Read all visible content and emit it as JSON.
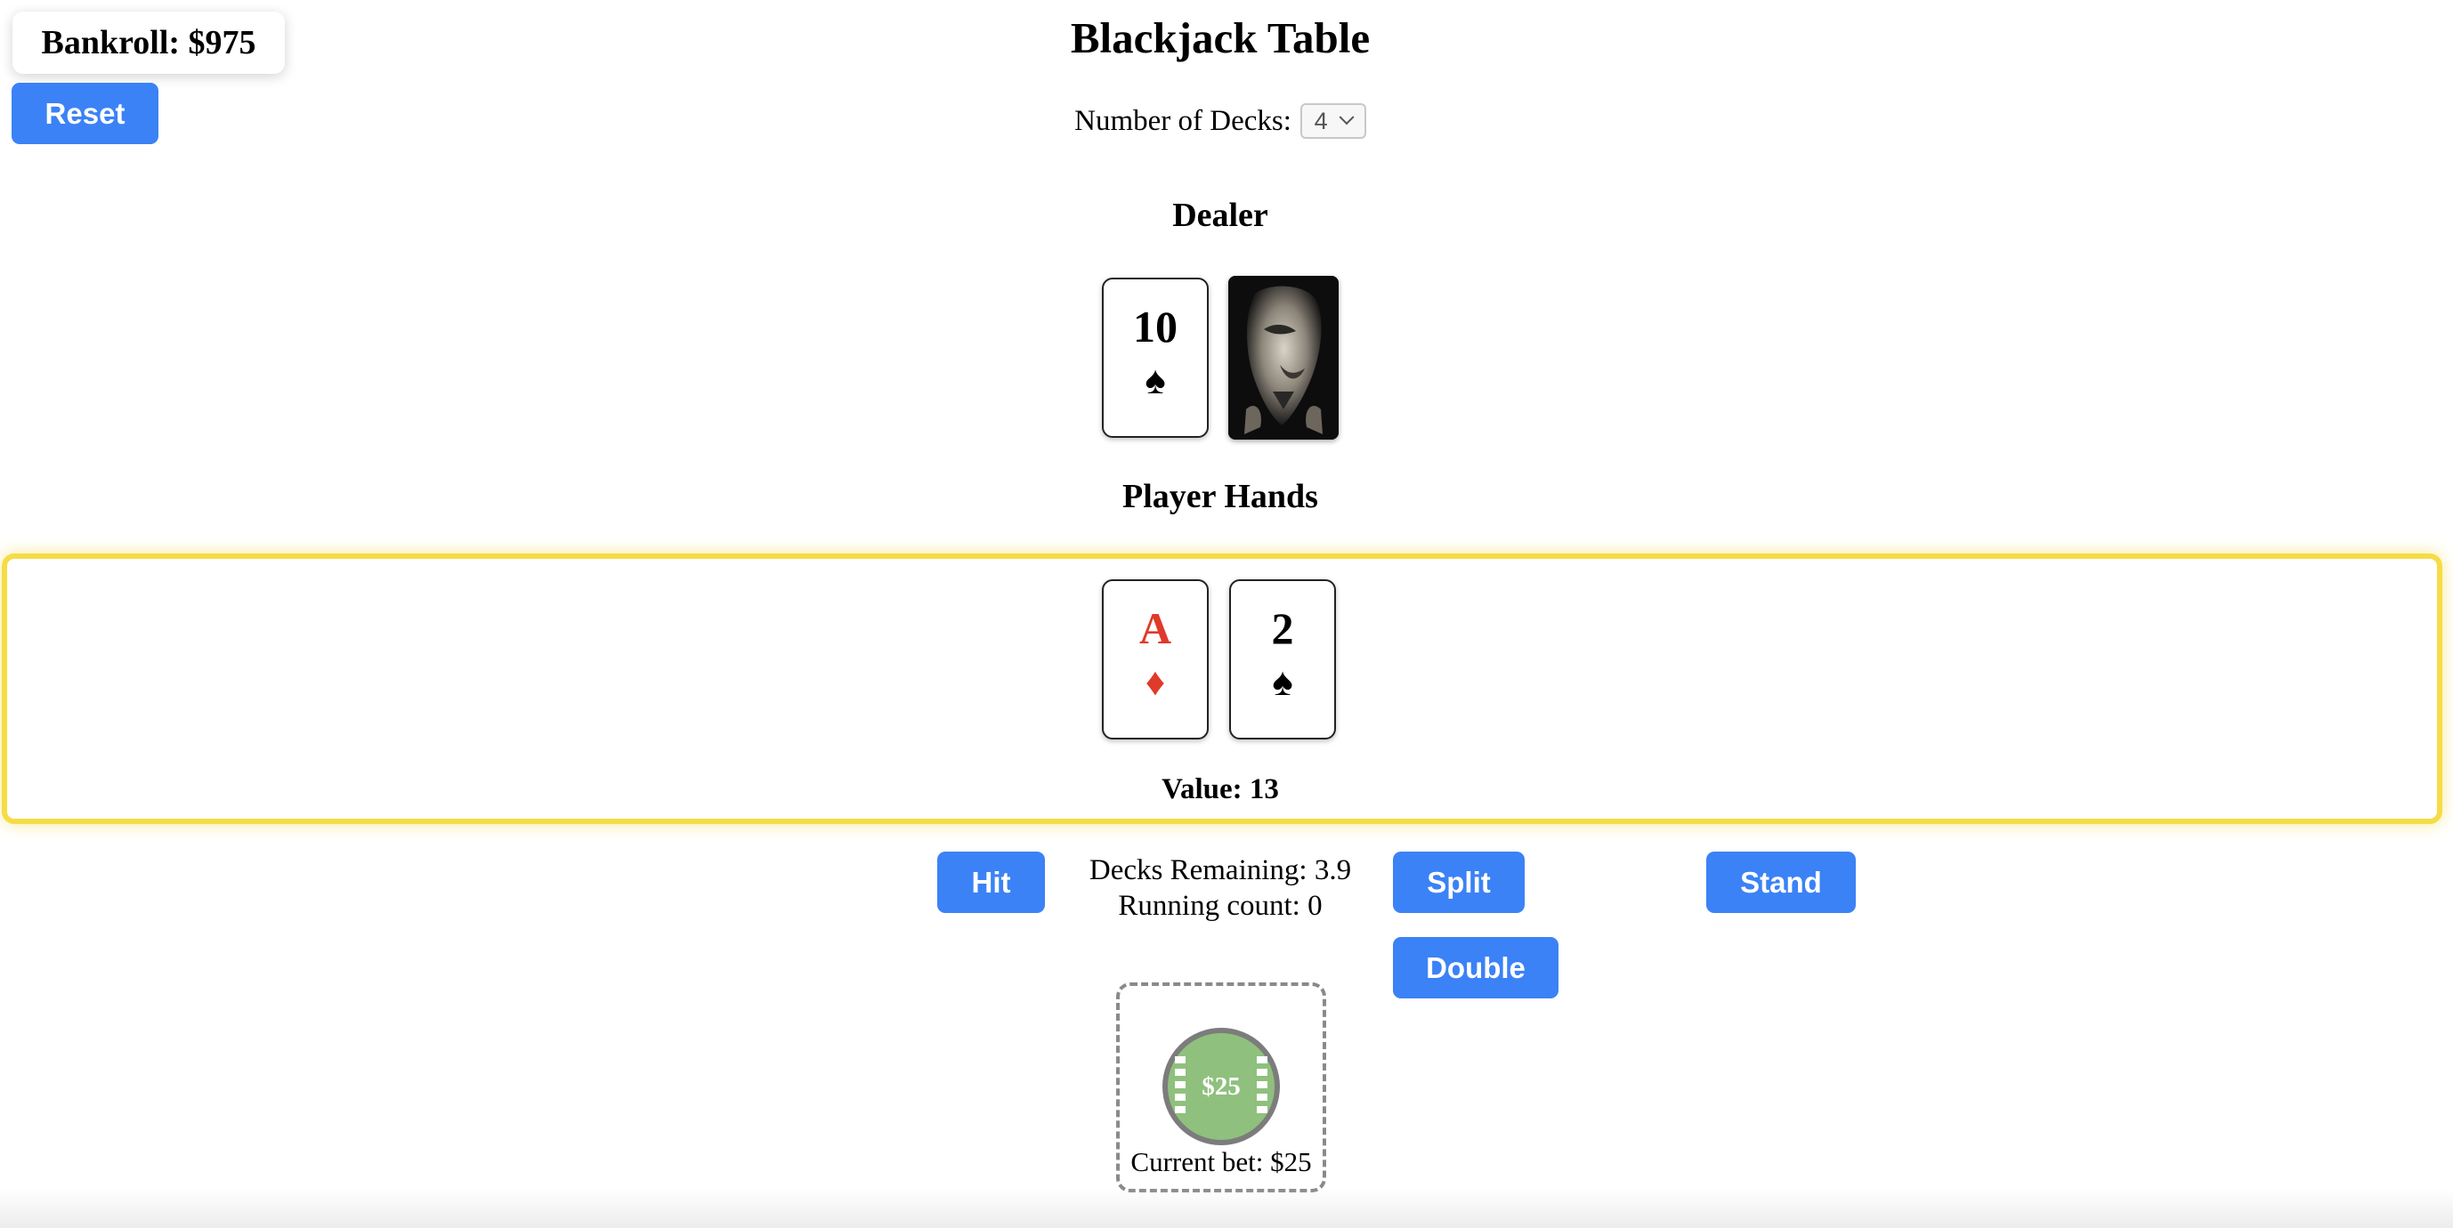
{
  "bankroll": {
    "label": "Bankroll: $975"
  },
  "reset_label": "Reset",
  "title": "Blackjack Table",
  "decks": {
    "label": "Number of Decks:",
    "selected": "4"
  },
  "dealer": {
    "heading": "Dealer",
    "cards": [
      {
        "rank": "10",
        "suit": "♠",
        "color": "#000000"
      }
    ],
    "hidden_card": "card-back-image"
  },
  "player": {
    "heading": "Player Hands",
    "cards": [
      {
        "rank": "A",
        "suit": "♦",
        "color": "#e03a2a"
      },
      {
        "rank": "2",
        "suit": "♠",
        "color": "#000000"
      }
    ],
    "value_label": "Value: 13"
  },
  "actions": {
    "hit": "Hit",
    "split": "Split",
    "stand": "Stand",
    "double": "Double"
  },
  "status": {
    "decks_remaining": "Decks Remaining: 3.9",
    "running_count": "Running count: 0"
  },
  "bet": {
    "chip_label": "$25",
    "current_bet": "Current bet: $25"
  },
  "colors": {
    "accent": "#3b82f6",
    "highlight": "#f5dc47",
    "chip": "#8fc07e",
    "red_suit": "#e03a2a"
  }
}
